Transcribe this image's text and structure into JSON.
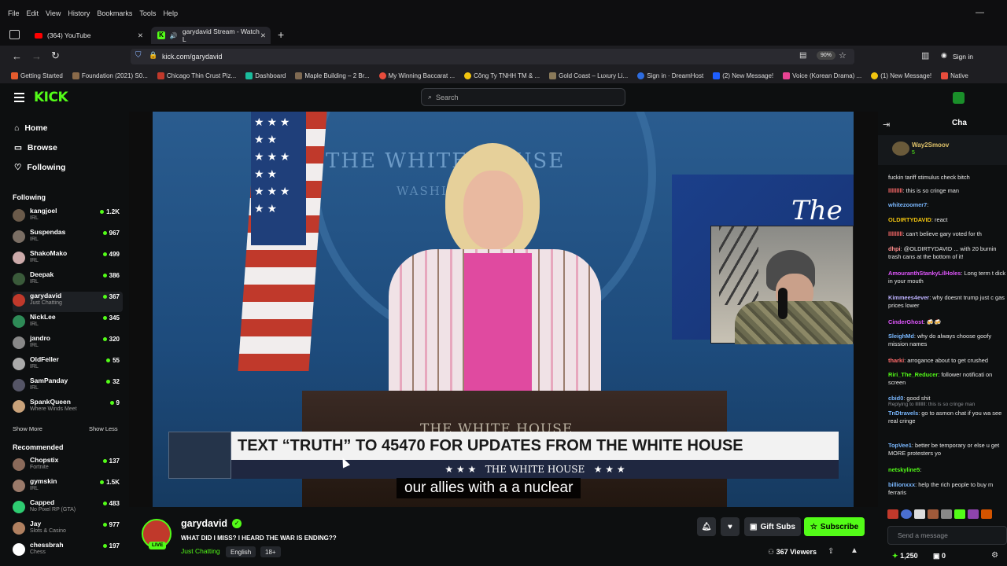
{
  "menu": [
    "File",
    "Edit",
    "View",
    "History",
    "Bookmarks",
    "Tools",
    "Help"
  ],
  "tabs": [
    {
      "title": "(364) YouTube"
    },
    {
      "title": "garydavid Stream - Watch L"
    }
  ],
  "url": "kick.com/garydavid",
  "zoom": "90%",
  "signin": "Sign in",
  "bookmarks": [
    "Getting Started",
    "Foundation (2021) S0...",
    "Chicago Thin Crust Piz...",
    "Dashboard",
    "Maple Building – 2 Br...",
    "My Winning Baccarat ...",
    "Công Ty TNHH TM & ...",
    "Gold Coast – Luxury Li...",
    "Sign in · DreamHost",
    "(2) New Message!",
    "Voice (Korean Drama) ...",
    "(1) New Message!",
    "Native"
  ],
  "kick": {
    "logo": "KICK",
    "search_placeholder": "Search",
    "nav": {
      "home": "Home",
      "browse": "Browse",
      "following": "Following"
    },
    "following_header": "Following",
    "following": [
      {
        "name": "kangjoel",
        "cat": "IRL",
        "viewers": "1.2K",
        "color": "#6a5a4a"
      },
      {
        "name": "Suspendas",
        "cat": "IRL",
        "viewers": "967",
        "color": "#7a6e64"
      },
      {
        "name": "ShakoMako",
        "cat": "IRL",
        "viewers": "499",
        "color": "#caa"
      },
      {
        "name": "Deepak",
        "cat": "IRL",
        "viewers": "386",
        "color": "#3a5a3a"
      },
      {
        "name": "garydavid",
        "cat": "Just Chatting",
        "viewers": "367",
        "color": "#c0392b"
      },
      {
        "name": "NickLee",
        "cat": "IRL",
        "viewers": "345",
        "color": "#2e8b57"
      },
      {
        "name": "jandro",
        "cat": "IRL",
        "viewers": "320",
        "color": "#888"
      },
      {
        "name": "OldFeller",
        "cat": "IRL",
        "viewers": "55",
        "color": "#aaa"
      },
      {
        "name": "SamPanday",
        "cat": "IRL",
        "viewers": "32",
        "color": "#556"
      },
      {
        "name": "SpankQueen",
        "cat": "Where Winds Meet",
        "viewers": "9",
        "color": "#c9a27a"
      }
    ],
    "show_more": "Show More",
    "show_less": "Show Less",
    "recommended_header": "Recommended",
    "recommended": [
      {
        "name": "Chopstix",
        "cat": "Fortnite",
        "viewers": "137",
        "color": "#8a6a5a"
      },
      {
        "name": "gymskin",
        "cat": "IRL",
        "viewers": "1.5K",
        "color": "#9a7a6a"
      },
      {
        "name": "Capped",
        "cat": "No Pixel RP (GTA)",
        "viewers": "483",
        "color": "#2ecc71"
      },
      {
        "name": "Jay",
        "cat": "Slots & Casino",
        "viewers": "977",
        "color": "#b08060"
      },
      {
        "name": "chessbrah",
        "cat": "Chess",
        "viewers": "197",
        "color": "#ffffff"
      }
    ]
  },
  "video": {
    "banner_text": "TEXT “TRUTH” TO 45470 FOR UPDATES FROM THE WHITE HOUSE",
    "banner_sub": "★ ★ ★   THE WHITE HOUSE   ★ ★ ★",
    "caption": "our allies with a a nuclear",
    "wall_text": "THE WHITE HOUSE",
    "wall_sub": "WASHINGTON",
    "podium_text": "THE WHITE HOUSE",
    "tv_text": "The W"
  },
  "stream": {
    "channel": "garydavid",
    "title": "WHAT DID I MISS? I HEARD THE WAR IS ENDING??",
    "category": "Just Chatting",
    "tags": [
      "English",
      "18+"
    ],
    "live": "LIVE",
    "gift": "Gift Subs",
    "subscribe": "Subscribe",
    "viewers": "367 Viewers"
  },
  "chat": {
    "header": "Cha",
    "pinned_user": "Way2Smoov",
    "pinned_count": "5",
    "messages": [
      {
        "user": "",
        "text": "fuckin tariff stimulus check bitch",
        "ucolor": "#ffffff"
      },
      {
        "user": "lllllllll",
        "text": ": this is so cringe man",
        "ucolor": "#ff6b6b"
      },
      {
        "user": "whitezoomer7",
        "text": ":",
        "ucolor": "#7ab8ff"
      },
      {
        "user": "OLDIRTYDAVID",
        "text": ": react",
        "ucolor": "#f1c40f"
      },
      {
        "user": "lllllllll",
        "text": ": can't believe gary voted for th",
        "ucolor": "#ff6b6b"
      },
      {
        "user": "dhpi",
        "text": ": @OLDIRTYDAVID ... with 20 burnin trash cans at the bottom of it!",
        "ucolor": "#ff8c8c"
      },
      {
        "user": "AmouranthStankyLilHoles",
        "text": ": Long term t dick in your mouth",
        "ucolor": "#e056fd"
      },
      {
        "user": "Kimmees4ever",
        "text": ": why doesnt trump just c gas prices lower",
        "ucolor": "#bdb2ff"
      },
      {
        "user": "CinderGhost",
        "text": ": 🍻🍻",
        "ucolor": "#e056fd"
      },
      {
        "user": "SleighMd",
        "text": ": why do always choose goofy mission names",
        "ucolor": "#7ab8ff"
      },
      {
        "user": "tharki",
        "text": ": arrogance about to get crushed",
        "ucolor": "#ff6b6b"
      },
      {
        "user": "Riri_The_Reducer",
        "text": ": follower notificati on screen",
        "ucolor": "#53fc18"
      },
      {
        "user": "cbid0",
        "text": ": good shit",
        "ucolor": "#7ab8ff"
      },
      {
        "user": "TnDtravels",
        "text": ": go to asmon chat if you wa see real cringe",
        "ucolor": "#7ab8ff",
        "reply": "Replying to lllllllll: this is so cringe man"
      },
      {
        "user": "TopVee1",
        "text": ": better be temporary or else u get MORE protesters yo",
        "ucolor": "#7ab8ff"
      },
      {
        "user": "netskyline5",
        "text": ":",
        "ucolor": "#53fc18"
      },
      {
        "user": "billionxxx",
        "text": ": help the rich people to buy m ferraris",
        "ucolor": "#7ab8ff"
      }
    ],
    "send_placeholder": "Send a message",
    "points": "1,250",
    "zero": "0"
  },
  "colors": {
    "kick_green": "#53fc18",
    "bg": "#0d0f10"
  }
}
